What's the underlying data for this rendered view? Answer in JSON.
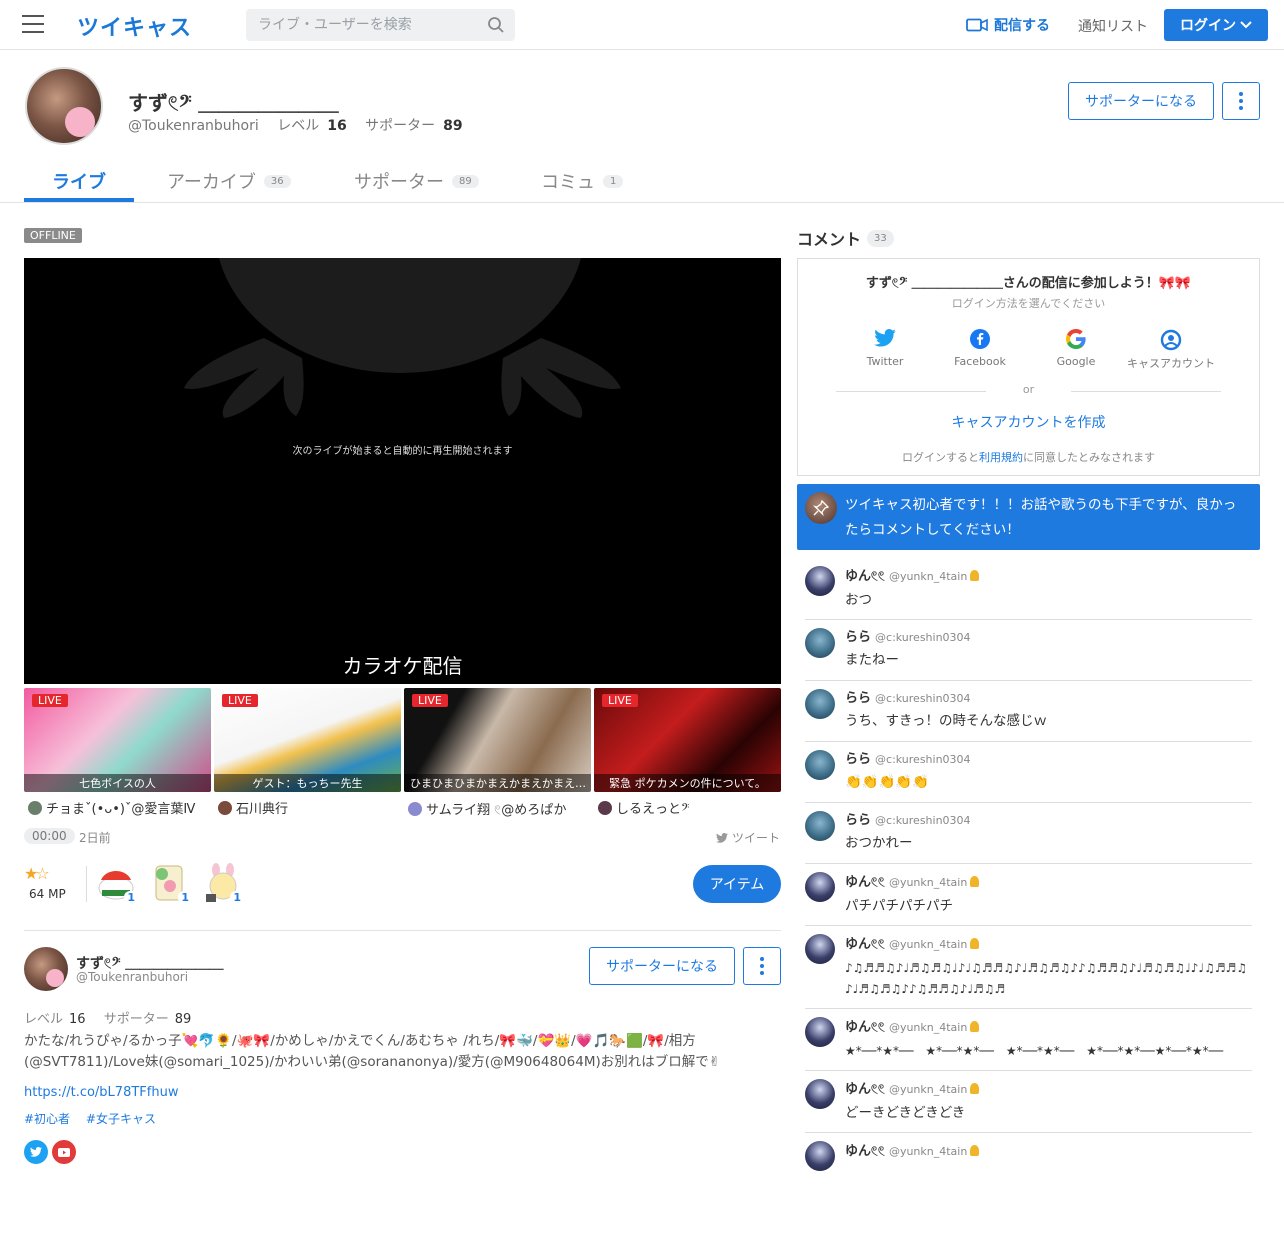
{
  "header": {
    "logo": "ツイキャス",
    "search_placeholder": "ライブ・ユーザーを検索",
    "broadcast_label": "配信する",
    "notify_label": "通知リスト",
    "login_label": "ログイン"
  },
  "profile": {
    "name": "すず𓏲𝄢 ＿＿＿＿＿＿＿",
    "handle": "@Toukenranbuhori",
    "level_label": "レベル",
    "level": "16",
    "supporter_label": "サポーター",
    "supporters": "89",
    "become_supporter": "サポーターになる"
  },
  "tabs": [
    {
      "label": "ライブ",
      "count": ""
    },
    {
      "label": "アーカイブ",
      "count": "36"
    },
    {
      "label": "サポーター",
      "count": "89"
    },
    {
      "label": "コミュ",
      "count": "1"
    }
  ],
  "player": {
    "status": "OFFLINE",
    "message": "次のライブが始まると自動的に再生開始されます",
    "title": "カラオケ配信",
    "time": "00:00",
    "ago": "2日前",
    "tweet_label": "ツイート"
  },
  "live_thumbs": [
    {
      "badge": "LIVE",
      "caption": "七色ボイスの人",
      "user": "チョまˇ(•ᴗ•)ˇ@愛言葉Ⅳ"
    },
    {
      "badge": "LIVE",
      "caption": "ゲスト：もっちー先生",
      "user": "石川典行"
    },
    {
      "badge": "LIVE",
      "caption": "ひまひまひまかまえかまえかまえ…",
      "user": "サムライ翔 𓏲@めろぱか"
    },
    {
      "badge": "LIVE",
      "caption": "緊急 ポケカメンの件について。",
      "user": "しるえっと𝄢"
    }
  ],
  "items": {
    "stars": "★☆",
    "mp": "64 MP",
    "gift_counts": [
      "1",
      "1",
      "1"
    ],
    "item_button": "アイテム"
  },
  "bio": {
    "name": "すず𓏲𝄢 ＿＿＿＿＿＿＿",
    "handle": "@Toukenranbuhori",
    "level_label": "レベル",
    "level": "16",
    "supporter_label": "サポーター",
    "supporters": "89",
    "become_supporter": "サポーターになる",
    "text": "かたな/れうぴゃ/るかっ子💘🐬🌻/🐙🎀/かめしゃ/かえでくん/あむちゃ /れち/🎀🐳/💝👑/💗🎵🐎🟩/🎀/相方(@SVT7811)/Love妹(@somari_1025)/かわいい弟(@sorananonya)/愛方(@M90648064M)お別れはブロ解で✌",
    "link": "https://t.co/bL78TFfhuw",
    "tags": [
      "#初心者",
      "#女子キャス"
    ]
  },
  "comments_panel": {
    "title": "コメント",
    "count": "33",
    "login_title": "すず𓏲𝄢 ＿＿＿＿＿＿＿さんの配信に参加しよう！🎀🎀",
    "login_sub": "ログイン方法を選んでください",
    "providers": [
      "Twitter",
      "Facebook",
      "Google",
      "キャスアカウント"
    ],
    "or": "or",
    "create": "キャスアカウントを作成",
    "note_pre": "ログインすると",
    "note_link": "利用規約",
    "note_post": "に同意したとみなされます",
    "pinned": "ツイキャス初心者です！！！お話や歌うのも下手ですが、良かったらコメントしてください！"
  },
  "comments": [
    {
      "name": "ゆん𓏲𓏲",
      "handle": "@yunkn_4tain",
      "text": "おつ"
    },
    {
      "name": "らら",
      "handle": "@c:kureshin0304",
      "text": "またねー"
    },
    {
      "name": "らら",
      "handle": "@c:kureshin0304",
      "text": "うち、すきっ！の時そんな感じｗ"
    },
    {
      "name": "らら",
      "handle": "@c:kureshin0304",
      "text": "👏👏👏👏👏"
    },
    {
      "name": "らら",
      "handle": "@c:kureshin0304",
      "text": "おつかれー"
    },
    {
      "name": "ゆん𓏲𓏲",
      "handle": "@yunkn_4tain",
      "text": "パチパチパチパチ"
    },
    {
      "name": "ゆん𓏲𓏲",
      "handle": "@yunkn_4tain",
      "text": "♪♫♬♬♫♪♩♬♫♬♫♩♪♩♫♬♬♫♪♩♬♫♬♫♪♪♫♬♬♫♪♩♬♫♬♫♩♪♩♫♬♬♫♪♩♬♫♬♫♪♪♫♬♬♫♪♩♬♫♬"
    },
    {
      "name": "ゆん𓏲𓏲",
      "handle": "@yunkn_4tain",
      "text": "★*──*★*──　★*──*★*──　★*──*★*──　★*──*★*──★*──*★*──"
    },
    {
      "name": "ゆん𓏲𓏲",
      "handle": "@yunkn_4tain",
      "text": "どーきどきどきどき"
    },
    {
      "name": "ゆん𓏲𓏲",
      "handle": "@yunkn_4tain",
      "text": ""
    }
  ],
  "colors": {
    "accent": "#1f7ae0",
    "live": "#e5262d"
  }
}
